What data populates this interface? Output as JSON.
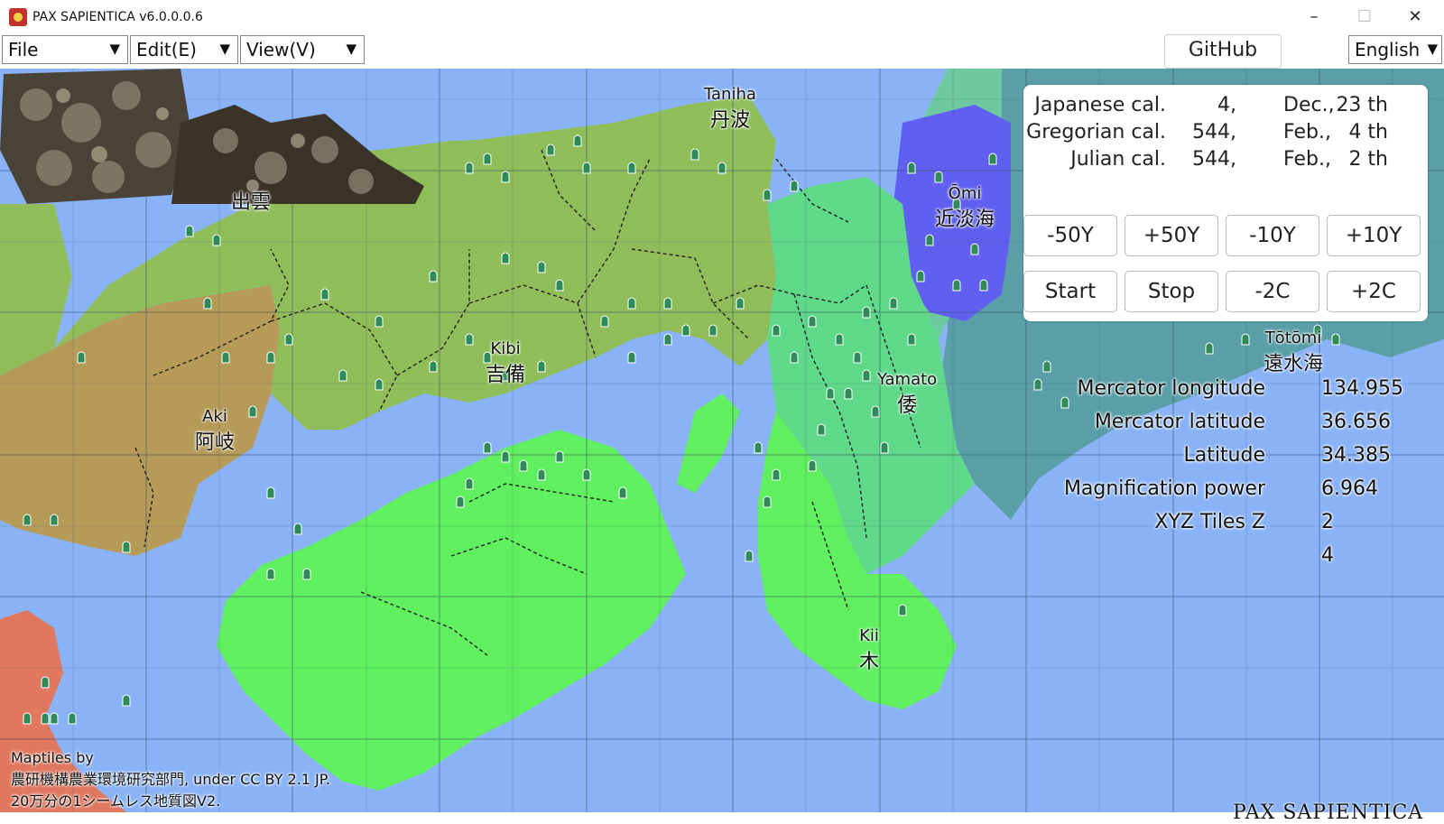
{
  "window": {
    "title": "PAX SAPIENTICA v6.0.0.0.6"
  },
  "menubar": {
    "items": [
      {
        "label": "File"
      },
      {
        "label": "Edit(E)"
      },
      {
        "label": "View(V)"
      }
    ],
    "github_label": "GitHub",
    "language": "English",
    "dropdown_glyph": "▼"
  },
  "calendar": {
    "rows": [
      {
        "name": "Japanese cal.",
        "year": "4,",
        "month": "Dec.,",
        "day": "23 th"
      },
      {
        "name": "Gregorian cal.",
        "year": "544,",
        "month": "Feb.,",
        "day": "4 th"
      },
      {
        "name": "Julian cal.",
        "year": "544,",
        "month": "Feb.,",
        "day": "2 th"
      }
    ]
  },
  "controls": {
    "minus50": "-50Y",
    "plus50": "+50Y",
    "minus10": "-10Y",
    "plus10": "+10Y",
    "start": "Start",
    "stop": "Stop",
    "minus2c": "-2C",
    "plus2c": "+2C"
  },
  "places": {
    "taniha": {
      "en": "Taniha",
      "jp": "丹波"
    },
    "omi": {
      "en": "Ōmi",
      "jp": "近淡海"
    },
    "kibi": {
      "en": "Kibi",
      "jp": "吉備"
    },
    "aki": {
      "en": "Aki",
      "jp": "阿岐"
    },
    "yamato": {
      "en": "Yamato",
      "jp": "倭"
    },
    "totomi": {
      "en": "Tōtōmi",
      "jp": "遠水海"
    },
    "kii": {
      "en": "Kii",
      "jp": "木"
    },
    "izumo": {
      "jp": "出雲"
    }
  },
  "coords": {
    "lon_label": "Mercator longitude",
    "lon_value": "134.955",
    "lat_label": "Mercator latitude",
    "lat_value": "36.656",
    "latitude_label": "Latitude",
    "latitude_value": "34.385",
    "mag_label": "Magnification power",
    "mag_value": "6.964",
    "tiles_label": "XYZ Tiles Z",
    "tiles_value": "2",
    "extra_value": "4"
  },
  "attribution": {
    "line1": "Maptiles by",
    "line2": "農研機構農業環境研究部門, under CC BY 2.1 JP.",
    "line3": "20万分の1シームレス地質図V2."
  },
  "watermark": "PAX SAPIENTICA",
  "colors": {
    "ocean": "#8ab3f7",
    "land_west": "#b69b58",
    "land_mid": "#8fbd5a",
    "land_east": "#5fef5f",
    "land_kinai": "#5fd88a",
    "lake_region": "#6060f0",
    "far_east": "#5a9fa8",
    "red_region": "#e07860"
  }
}
